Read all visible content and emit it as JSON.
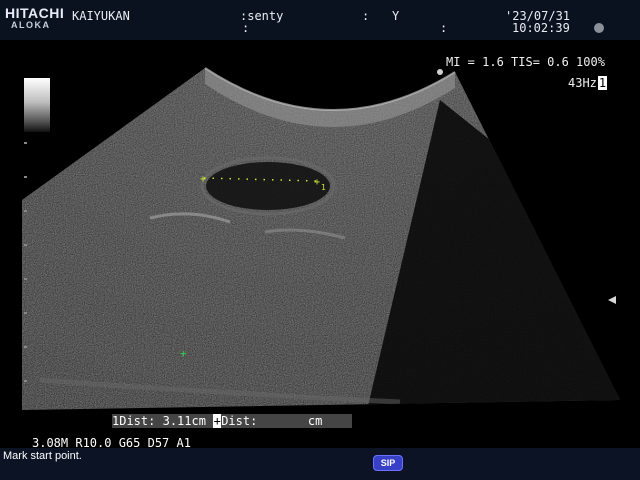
{
  "header": {
    "brand": "HITACHI",
    "brand_sub": "ALOKA",
    "hospital": "KAIYUKAN",
    "patient_name": ":senty",
    "colon_mid": ":",
    "sex": "Y",
    "colon_row2_left": ":",
    "colon_row2_mid": ":",
    "date": "'23/07/31",
    "time": "10:02:39"
  },
  "info": {
    "mi_tis": "MI = 1.6 TIS= 0.6 100%",
    "frame_rate": "43Hz",
    "frame_box": "1"
  },
  "measurement": {
    "dist1_label": "1Dist:",
    "dist1_value": "3.11cm",
    "cursor_symbol": "+",
    "dist2_label": "Dist:",
    "dist2_unit": "cm",
    "caliper_index": "1"
  },
  "params": "3.08M R10.0 G65 D57 A1",
  "status": {
    "message": "Mark start point.",
    "sip_label": "SIP"
  },
  "colors": {
    "caliper": "#c8e632",
    "cursor_green": "#2ed24a",
    "header_bg": "#0a1220"
  }
}
